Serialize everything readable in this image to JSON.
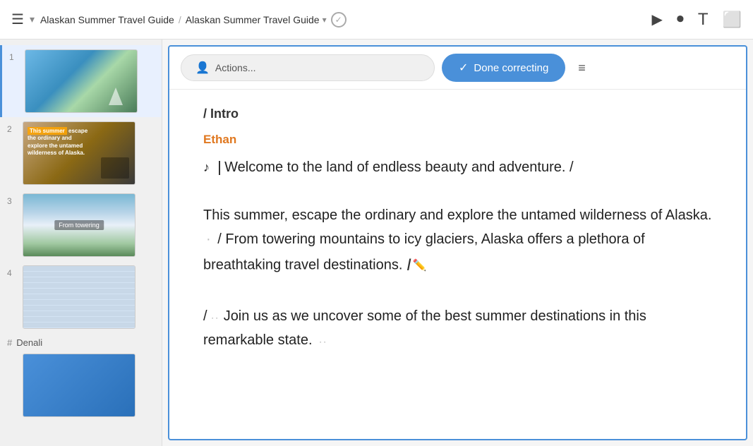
{
  "topbar": {
    "menu_icon": "☰",
    "chevron_down": "▾",
    "breadcrumb": {
      "item1": "Alaskan Summer Travel Guide",
      "separator": "/",
      "item2": "Alaskan Summer Travel Guide",
      "arrow": "▾"
    },
    "icons": {
      "play": "▶",
      "record": "⏺",
      "text": "T",
      "frame": "⬜"
    }
  },
  "sidebar": {
    "slides": [
      {
        "number": "1",
        "active": true
      },
      {
        "number": "2",
        "active": false
      },
      {
        "number": "3",
        "active": false
      },
      {
        "number": "4",
        "active": false
      }
    ],
    "section_label": "Denali",
    "hash": "#",
    "slide5_active": false
  },
  "toolbar": {
    "actions_label": "Actions...",
    "actions_icon": "👤",
    "done_label": "Done correcting",
    "done_check": "✓",
    "list_icon": "≡"
  },
  "script": {
    "section": "/ Intro",
    "speaker": "Ethan",
    "music_note": "♪",
    "text_part1": "Welcome to the land of endless beauty and adventure. /",
    "text_part2": "This summer, escape the ordinary and explore the untamed wilderness of Alaska.",
    "divider1": "·",
    "text_part3": "/ From towering mountains to icy glaciers, Alaska offers a plethora of breathtaking travel destinations.",
    "text_part4": "/ ",
    "ellipsis1": "··",
    "text_part5": "Join us as we uncover some of the best summer destinations in this remarkable state.",
    "ellipsis2": "··"
  }
}
